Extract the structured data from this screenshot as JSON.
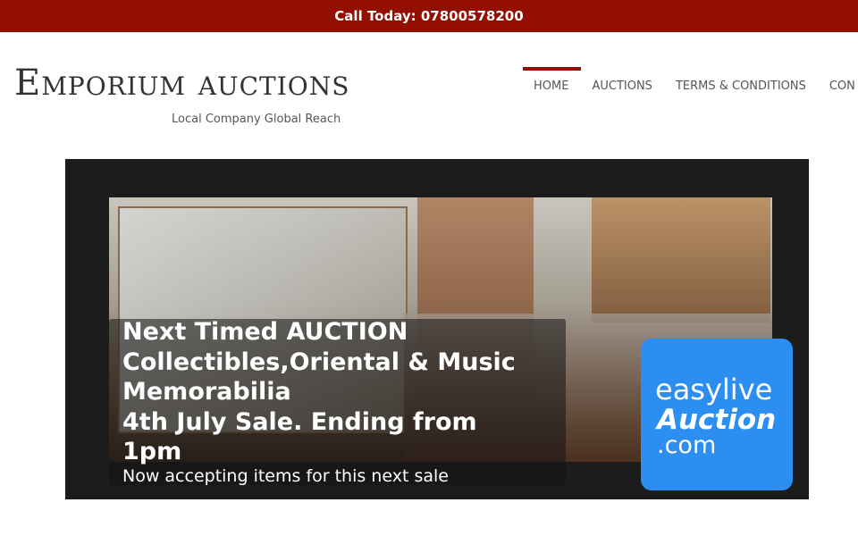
{
  "topbar": {
    "call_text": "Call Today: 07800578200"
  },
  "header": {
    "logo": "Emporium auctions",
    "tagline": "Local Company Global Reach"
  },
  "nav": {
    "items": [
      {
        "label": "HOME",
        "active": true
      },
      {
        "label": "AUCTIONS",
        "active": false
      },
      {
        "label": "TERMS & CONDITIONS",
        "active": false
      },
      {
        "label": "CON",
        "active": false
      }
    ]
  },
  "slide": {
    "title_lines": [
      "Next Timed AUCTION",
      "Collectibles,Oriental & Music Memorabilia",
      "4th July Sale. Ending from 1pm"
    ],
    "subtitle": "Now accepting items for this next sale"
  },
  "badge": {
    "line1": "easylive",
    "line2": "Auction",
    "line3": ".com"
  },
  "colors": {
    "brand_red": "#930f02",
    "slider_bg": "#1c1c1c",
    "badge_blue": "#2b8ef0"
  }
}
